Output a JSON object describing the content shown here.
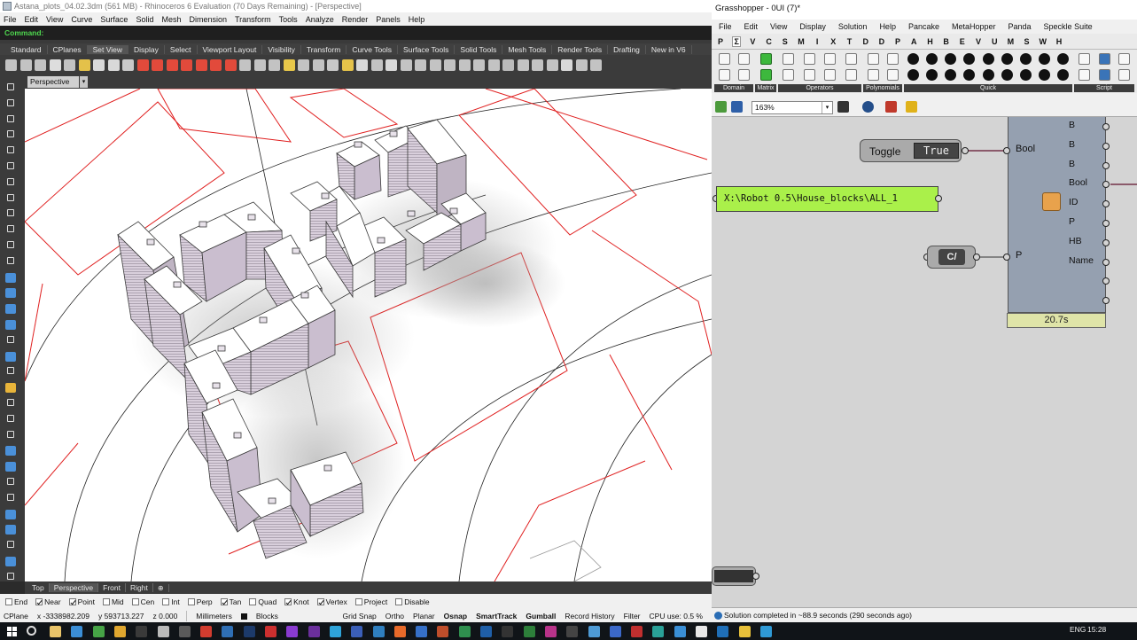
{
  "rhino": {
    "title": "Astana_plots_04.02.3dm (561 MB) - Rhinoceros 6 Evaluation (70 Days Remaining) - [Perspective]",
    "menu": [
      "File",
      "Edit",
      "View",
      "Curve",
      "Surface",
      "Solid",
      "Mesh",
      "Dimension",
      "Transform",
      "Tools",
      "Analyze",
      "Render",
      "Panels",
      "Help"
    ],
    "command_prompt": "Command:",
    "toolbar_tabs": [
      "Standard",
      "CPlanes",
      "Set View",
      "Display",
      "Select",
      "Viewport Layout",
      "Visibility",
      "Transform",
      "Curve Tools",
      "Surface Tools",
      "Solid Tools",
      "Mesh Tools",
      "Render Tools",
      "Drafting",
      "New in V6"
    ],
    "active_toolbar_tab": "Set View",
    "viewport_title": "Perspective",
    "viewport_tabs": [
      "Top",
      "Perspective",
      "Front",
      "Right"
    ],
    "active_viewport_tab": "Perspective",
    "osnaps": [
      {
        "label": "End",
        "checked": false
      },
      {
        "label": "Near",
        "checked": true
      },
      {
        "label": "Point",
        "checked": true
      },
      {
        "label": "Mid",
        "checked": false
      },
      {
        "label": "Cen",
        "checked": false
      },
      {
        "label": "Int",
        "checked": false
      },
      {
        "label": "Perp",
        "checked": false
      },
      {
        "label": "Tan",
        "checked": true
      },
      {
        "label": "Quad",
        "checked": false
      },
      {
        "label": "Knot",
        "checked": true
      },
      {
        "label": "Vertex",
        "checked": true
      },
      {
        "label": "Project",
        "checked": false
      },
      {
        "label": "Disable",
        "checked": false
      }
    ],
    "status": {
      "cplane": "CPlane",
      "x": "x -3338982.209",
      "y": "y 593713.227",
      "z": "z 0.000",
      "units": "Millimeters",
      "layer": "Blocks",
      "toggles": [
        {
          "label": "Grid Snap",
          "bold": false
        },
        {
          "label": "Ortho",
          "bold": false
        },
        {
          "label": "Planar",
          "bold": false
        },
        {
          "label": "Osnap",
          "bold": true
        },
        {
          "label": "SmartTrack",
          "bold": true
        },
        {
          "label": "Gumball",
          "bold": true
        },
        {
          "label": "Record History",
          "bold": false
        },
        {
          "label": "Filter",
          "bold": false
        }
      ],
      "cpu": "CPU use: 0.5 %"
    }
  },
  "grasshopper": {
    "title": "Grasshopper - 0UI (7)*",
    "menu": [
      "File",
      "Edit",
      "View",
      "Display",
      "Solution",
      "Help",
      "Pancake",
      "MetaHopper",
      "Panda",
      "Speckle Suite"
    ],
    "category_tabs": [
      "P",
      "Σ",
      "V",
      "C",
      "S",
      "M",
      "I",
      "X",
      "T",
      "D",
      "D",
      "P",
      "A",
      "H",
      "B",
      "E",
      "V",
      "U",
      "M",
      "S",
      "W",
      "H"
    ],
    "ribbon_groups": [
      "Domain",
      "Matrix",
      "Operators",
      "Polynomials",
      "Quick",
      "Script"
    ],
    "zoom": "163%",
    "toggle": {
      "label": "Toggle",
      "value": "True"
    },
    "panel_text": "X:\\Robot 0.5\\House_blocks\\ALL_1",
    "param_icon": "C/",
    "component": {
      "inputs": [
        "Bool",
        "P"
      ],
      "outputs": [
        "B",
        "B",
        "B",
        "Bool",
        "ID",
        "P",
        "HB",
        "Name"
      ],
      "timer": "20.7s"
    },
    "status": "Solution completed in ~88.9 seconds (290 seconds ago)"
  },
  "taskbar": {
    "lang": "ENG",
    "time": "15:28"
  },
  "colors": {
    "command_green": "#4fd84f",
    "panel_green": "#aaf04a",
    "plot_red": "#e02020",
    "grasshopper_canvas": "#d4d4d4"
  }
}
